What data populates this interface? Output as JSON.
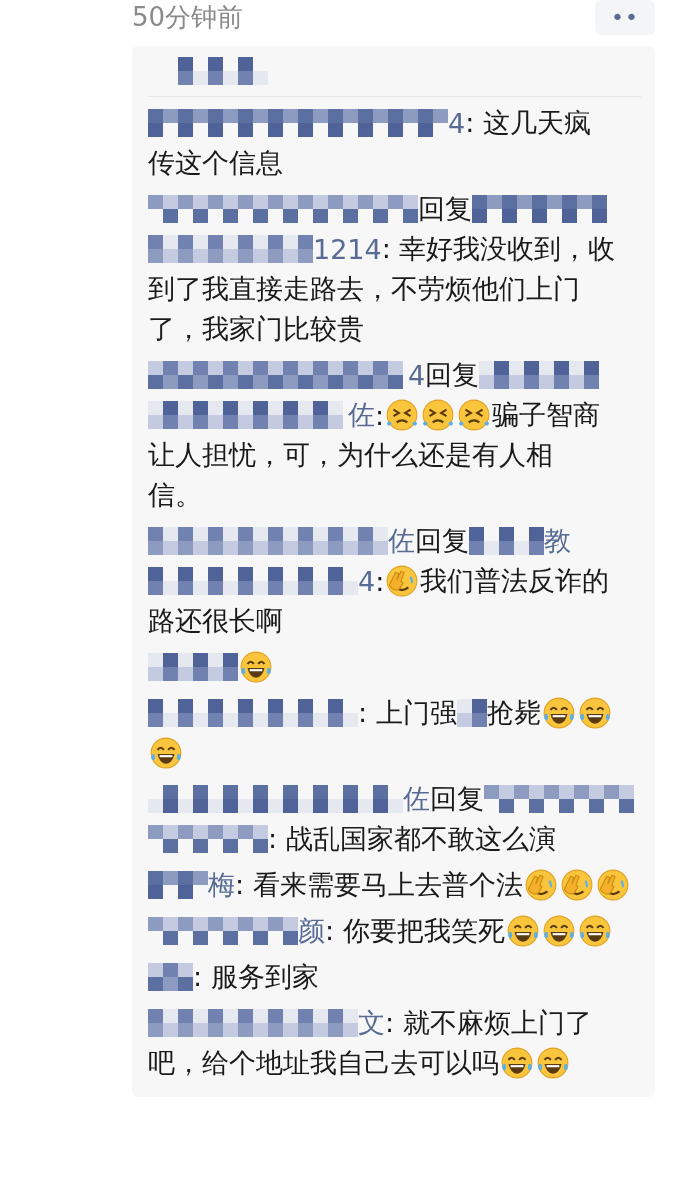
{
  "time": "50分钟前",
  "more_button": {
    "label": "••"
  },
  "likes": [
    {
      "kind": "picture"
    }
  ],
  "comments": [
    {
      "lines": [
        [
          {
            "kind": "picture"
          },
          {
            "kind": "name",
            "text": "4"
          },
          {
            "kind": "text",
            "text": ": 这几天疯"
          }
        ],
        [
          {
            "kind": "text",
            "text": "传这个信息"
          }
        ]
      ]
    },
    {
      "lines": [
        [
          {
            "kind": "picture"
          },
          {
            "kind": "reply",
            "text": "回复"
          },
          {
            "kind": "picture"
          }
        ],
        [
          {
            "kind": "picture"
          },
          {
            "kind": "name",
            "text": "1214"
          },
          {
            "kind": "text",
            "text": ": 幸好我没收到，收"
          }
        ],
        [
          {
            "kind": "text",
            "text": "到了我直接走路去，不劳烦他们上门"
          }
        ],
        [
          {
            "kind": "text",
            "text": "了，我家门比较贵"
          }
        ]
      ]
    },
    {
      "lines": [
        [
          {
            "kind": "picture"
          },
          {
            "kind": "name",
            "text": "4"
          },
          {
            "kind": "reply",
            "text": "回复"
          },
          {
            "kind": "picture"
          }
        ],
        [
          {
            "kind": "picture"
          },
          {
            "kind": "name",
            "text": "佐"
          },
          {
            "kind": "text",
            "text": ":"
          },
          {
            "kind": "squint"
          },
          {
            "kind": "squint"
          },
          {
            "kind": "squint"
          },
          {
            "kind": "text",
            "text": "骗子智商"
          }
        ],
        [
          {
            "kind": "text",
            "text": "让人担忧，可，为什么还是有人相"
          }
        ],
        [
          {
            "kind": "text",
            "text": "信。"
          }
        ]
      ]
    },
    {
      "lines": [
        [
          {
            "kind": "picture"
          },
          {
            "kind": "name",
            "text": "佐"
          },
          {
            "kind": "reply",
            "text": "回复"
          },
          {
            "kind": "picture"
          },
          {
            "kind": "name",
            "text": "教"
          }
        ],
        [
          {
            "kind": "picture"
          },
          {
            "kind": "name",
            "text": "4"
          },
          {
            "kind": "text",
            "text": ":"
          },
          {
            "kind": "facepalm"
          },
          {
            "kind": "text",
            "text": "我们普法反诈的"
          }
        ],
        [
          {
            "kind": "text",
            "text": "路还很长啊"
          }
        ]
      ]
    },
    {
      "lines": [
        [
          {
            "kind": "picture"
          },
          {
            "kind": "laugh"
          }
        ]
      ]
    },
    {
      "lines": [
        [
          {
            "kind": "picture"
          },
          {
            "kind": "text",
            "text": ": 上门强"
          },
          {
            "kind": "picture"
          },
          {
            "kind": "text",
            "text": "抢毙"
          },
          {
            "kind": "laugh"
          },
          {
            "kind": "laugh"
          }
        ],
        [
          {
            "kind": "laugh"
          }
        ]
      ]
    },
    {
      "lines": [
        [
          {
            "kind": "picture"
          },
          {
            "kind": "name",
            "text": "佐"
          },
          {
            "kind": "reply",
            "text": "回复"
          },
          {
            "kind": "picture"
          }
        ],
        [
          {
            "kind": "picture"
          },
          {
            "kind": "text",
            "text": ": 战乱国家都不敢这么演"
          }
        ]
      ]
    },
    {
      "lines": [
        [
          {
            "kind": "picture"
          },
          {
            "kind": "name",
            "text": "梅"
          },
          {
            "kind": "text",
            "text": ": 看来需要马上去普个法"
          },
          {
            "kind": "facepalm"
          },
          {
            "kind": "facepalm"
          },
          {
            "kind": "facepalm"
          }
        ]
      ]
    },
    {
      "lines": [
        [
          {
            "kind": "picture"
          },
          {
            "kind": "name",
            "text": "颜"
          },
          {
            "kind": "text",
            "text": ": 你要把我笑死"
          },
          {
            "kind": "laugh"
          },
          {
            "kind": "laugh"
          },
          {
            "kind": "laugh"
          }
        ]
      ]
    },
    {
      "lines": [
        [
          {
            "kind": "picture"
          },
          {
            "kind": "text",
            "text": ": 服务到家"
          }
        ]
      ]
    },
    {
      "lines": [
        [
          {
            "kind": "picture"
          },
          {
            "kind": "name",
            "text": "文"
          },
          {
            "kind": "text",
            "text": ": 就不麻烦上门了"
          }
        ],
        [
          {
            "kind": "text",
            "text": "吧，给个地址我自己去可以吗"
          },
          {
            "kind": "laugh"
          },
          {
            "kind": "laugh"
          }
        ]
      ]
    }
  ]
}
